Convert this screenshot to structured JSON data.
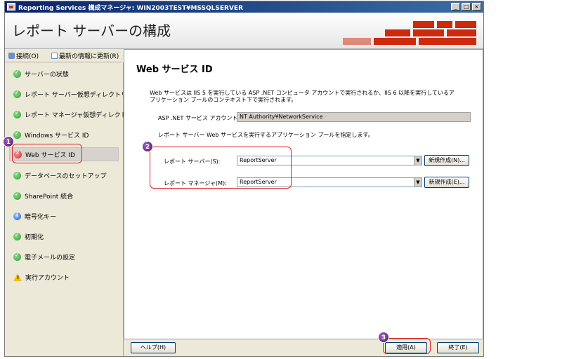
{
  "window": {
    "title": "Reporting Services 構成マネージャ: WIN2003TEST¥MSSQLSERVER",
    "minimize": "_",
    "maximize": "□",
    "close": "×"
  },
  "header": {
    "title": "レポート サーバーの構成"
  },
  "toolbar": {
    "connect_label": "接続(O)",
    "refresh_label": "最新の情報に更新(R)"
  },
  "sidebar": {
    "items": [
      {
        "label": "サーバーの状態",
        "icon": "ok-icon"
      },
      {
        "label": "レポート サーバー仮想ディレクトリ",
        "icon": "ok-icon"
      },
      {
        "label": "レポート マネージャ仮想ディレクトリ",
        "icon": "ok-icon"
      },
      {
        "label": "Windows サービス ID",
        "icon": "ok-icon"
      },
      {
        "label": "Web サービス ID",
        "icon": "error-icon"
      },
      {
        "label": "データベースのセットアップ",
        "icon": "ok-icon"
      },
      {
        "label": "SharePoint 統合",
        "icon": "ok-icon"
      },
      {
        "label": "暗号化キー",
        "icon": "info-icon"
      },
      {
        "label": "初期化",
        "icon": "ok-icon"
      },
      {
        "label": "電子メールの設定",
        "icon": "ok-icon"
      },
      {
        "label": "実行アカウント",
        "icon": "warning-icon"
      }
    ]
  },
  "main": {
    "title": "Web サービス ID",
    "description": "Web サービスは IIS 5 を実行している ASP .NET コンピュータ アカウントで実行されるか、IIS 6 以降を実行しているアプリケーション プールのコンテキスト下で実行されます。",
    "asp_account_label": "ASP .NET サービス アカウント:",
    "asp_account_value": "NT Authority¥NetworkService",
    "app_pool_instruction": "レポート サーバー Web サービスを実行するアプリケーション プールを指定します。",
    "report_server_label": "レポート サーバー(S):",
    "report_server_value": "ReportServer",
    "report_manager_label": "レポート マネージャ(M):",
    "report_manager_value": "ReportServer",
    "new_button_1": "新規作成(N)...",
    "new_button_2": "新規作成(E)..."
  },
  "footer": {
    "help_label": "ヘルプ(H)",
    "apply_label": "適用(A)",
    "exit_label": "終了(E)"
  },
  "callouts": [
    "1",
    "2",
    "3"
  ],
  "colors": {
    "accent_red": "#cc2a0c",
    "highlight": "#e02020",
    "callout": "#6b2a8a"
  }
}
